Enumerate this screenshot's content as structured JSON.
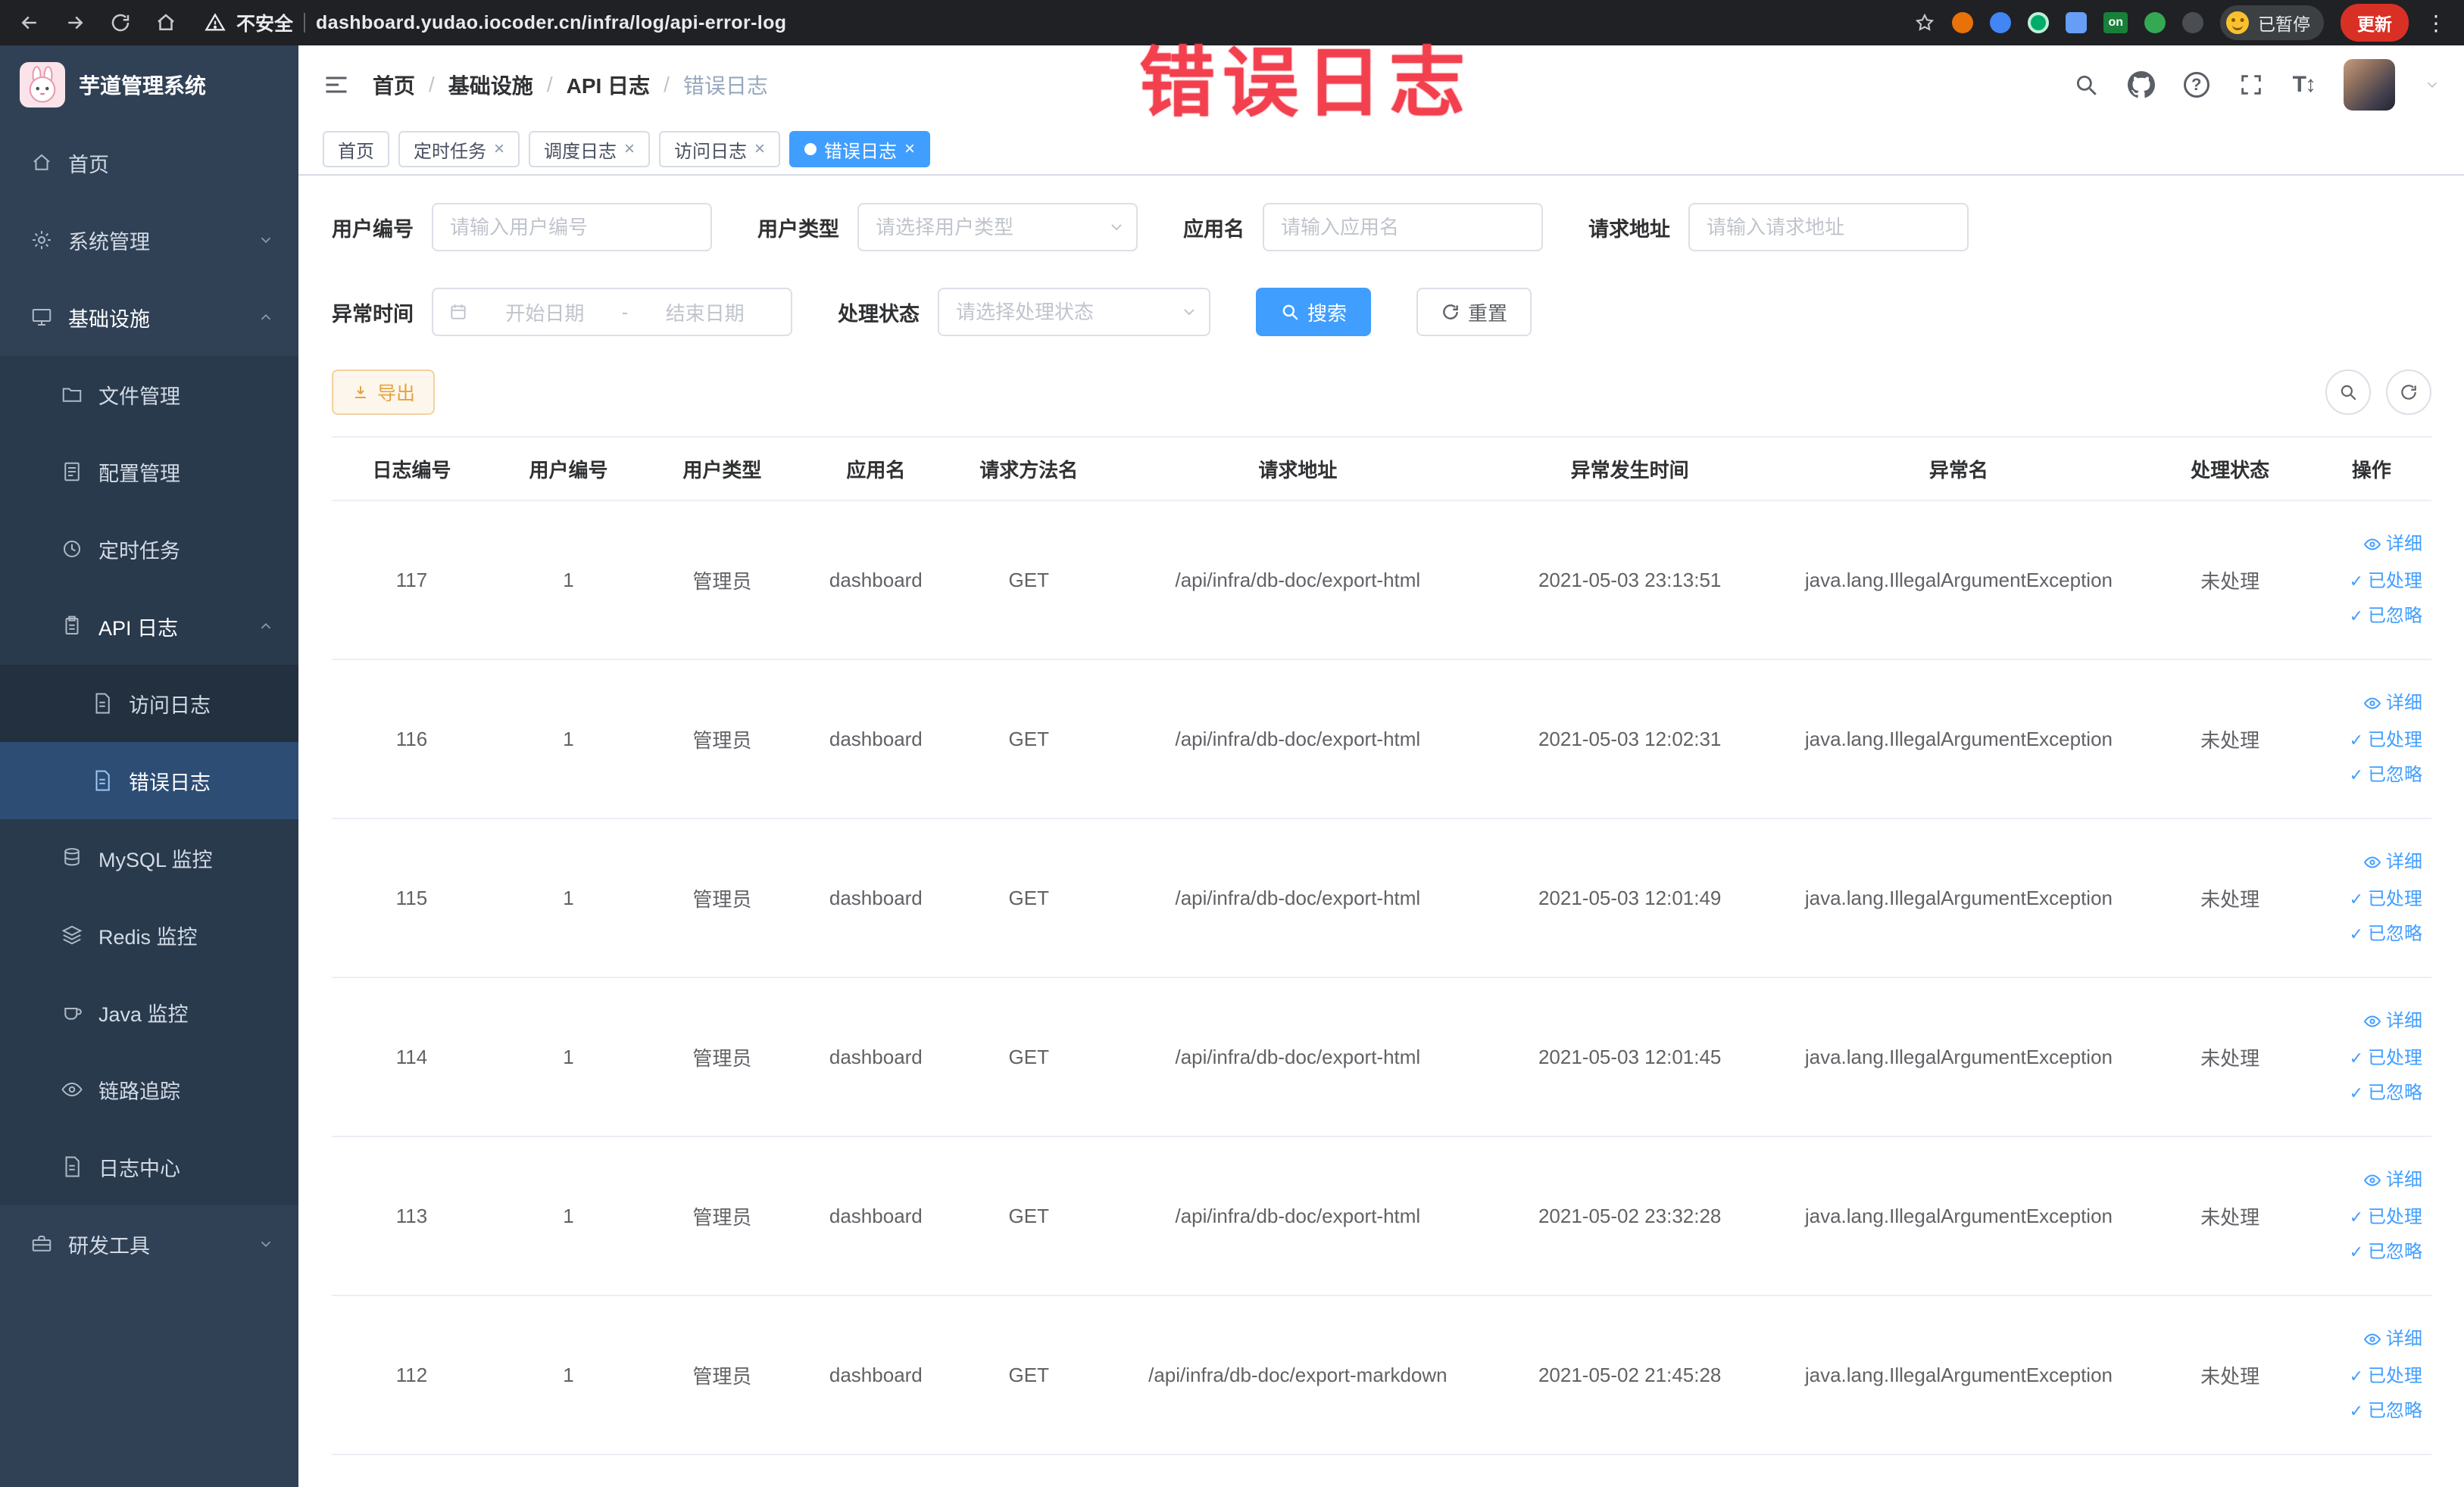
{
  "watermark": "错误日志",
  "browser": {
    "security_text": "不安全",
    "url": "dashboard.yudao.iocoder.cn/infra/log/api-error-log",
    "extension_badge": "on",
    "paused_label": "已暂停",
    "update_label": "更新"
  },
  "sidebar": {
    "logo_text": "芋道管理系统",
    "items": {
      "home": "首页",
      "system": "系统管理",
      "infra": "基础设施",
      "file": "文件管理",
      "config": "配置管理",
      "job": "定时任务",
      "api_log": "API 日志",
      "access_log": "访问日志",
      "error_log": "错误日志",
      "mysql": "MySQL 监控",
      "redis": "Redis 监控",
      "java": "Java 监控",
      "trace": "链路追踪",
      "log_center": "日志中心",
      "dev_tools": "研发工具"
    }
  },
  "breadcrumb": [
    "首页",
    "基础设施",
    "API 日志",
    "错误日志"
  ],
  "tabs": {
    "home": "首页",
    "job": "定时任务",
    "job_log": "调度日志",
    "access_log": "访问日志",
    "error_log": "错误日志"
  },
  "filters": {
    "user_id_label": "用户编号",
    "user_id_placeholder": "请输入用户编号",
    "user_type_label": "用户类型",
    "user_type_placeholder": "请选择用户类型",
    "app_name_label": "应用名",
    "app_name_placeholder": "请输入应用名",
    "request_url_label": "请求地址",
    "request_url_placeholder": "请输入请求地址",
    "time_label": "异常时间",
    "time_start_placeholder": "开始日期",
    "time_separator": "-",
    "time_end_placeholder": "结束日期",
    "status_label": "处理状态",
    "status_placeholder": "请选择处理状态",
    "search_label": "搜索",
    "reset_label": "重置"
  },
  "toolbar": {
    "export_label": "导出"
  },
  "table": {
    "columns": [
      "日志编号",
      "用户编号",
      "用户类型",
      "应用名",
      "请求方法名",
      "请求地址",
      "异常发生时间",
      "异常名",
      "处理状态",
      "操作"
    ],
    "actions": {
      "detail": "详细",
      "processed": "已处理",
      "ignored": "已忽略"
    },
    "rows": [
      {
        "log_id": "117",
        "user_id": "1",
        "user_type": "管理员",
        "app_name": "dashboard",
        "method": "GET",
        "url": "/api/infra/db-doc/export-html",
        "time": "2021-05-03 23:13:51",
        "exception": "java.lang.IllegalArgumentException",
        "status": "未处理"
      },
      {
        "log_id": "116",
        "user_id": "1",
        "user_type": "管理员",
        "app_name": "dashboard",
        "method": "GET",
        "url": "/api/infra/db-doc/export-html",
        "time": "2021-05-03 12:02:31",
        "exception": "java.lang.IllegalArgumentException",
        "status": "未处理"
      },
      {
        "log_id": "115",
        "user_id": "1",
        "user_type": "管理员",
        "app_name": "dashboard",
        "method": "GET",
        "url": "/api/infra/db-doc/export-html",
        "time": "2021-05-03 12:01:49",
        "exception": "java.lang.IllegalArgumentException",
        "status": "未处理"
      },
      {
        "log_id": "114",
        "user_id": "1",
        "user_type": "管理员",
        "app_name": "dashboard",
        "method": "GET",
        "url": "/api/infra/db-doc/export-html",
        "time": "2021-05-03 12:01:45",
        "exception": "java.lang.IllegalArgumentException",
        "status": "未处理"
      },
      {
        "log_id": "113",
        "user_id": "1",
        "user_type": "管理员",
        "app_name": "dashboard",
        "method": "GET",
        "url": "/api/infra/db-doc/export-html",
        "time": "2021-05-02 23:32:28",
        "exception": "java.lang.IllegalArgumentException",
        "status": "未处理"
      },
      {
        "log_id": "112",
        "user_id": "1",
        "user_type": "管理员",
        "app_name": "dashboard",
        "method": "GET",
        "url": "/api/infra/db-doc/export-markdown",
        "time": "2021-05-02 21:45:28",
        "exception": "java.lang.IllegalArgumentException",
        "status": "未处理"
      }
    ]
  }
}
